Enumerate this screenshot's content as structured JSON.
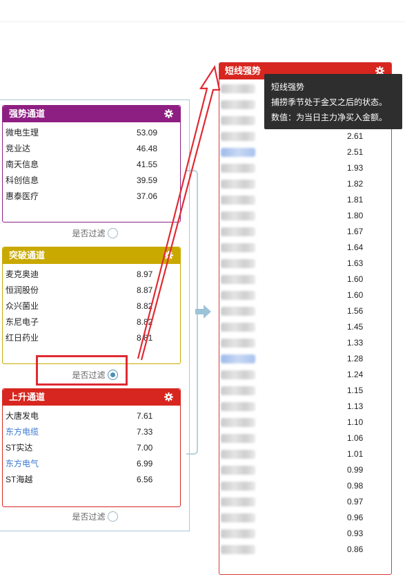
{
  "panels": {
    "strong": {
      "title": "强势通道",
      "color": "#8e1f82",
      "rows": [
        {
          "name": "微电生理",
          "value": "53.09",
          "link": false
        },
        {
          "name": "竞业达",
          "value": "46.48",
          "link": false
        },
        {
          "name": "南天信息",
          "value": "41.55",
          "link": false
        },
        {
          "name": "科创信息",
          "value": "39.59",
          "link": false
        },
        {
          "name": "惠泰医疗",
          "value": "37.06",
          "link": false
        }
      ],
      "filter_label": "是否过滤",
      "filter_on": false
    },
    "breakout": {
      "title": "突破通道",
      "color": "#c9a900",
      "rows": [
        {
          "name": "麦克奥迪",
          "value": "8.97",
          "link": false
        },
        {
          "name": "恒润股份",
          "value": "8.87",
          "link": false
        },
        {
          "name": "众兴菌业",
          "value": "8.82",
          "link": false
        },
        {
          "name": "东尼电子",
          "value": "8.82",
          "link": false
        },
        {
          "name": "红日药业",
          "value": "8.81",
          "link": false
        }
      ],
      "filter_label": "是否过滤",
      "filter_on": true
    },
    "rising": {
      "title": "上升通道",
      "color": "#d7261f",
      "rows": [
        {
          "name": "大唐发电",
          "value": "7.61",
          "link": false
        },
        {
          "name": "东方电缆",
          "value": "7.33",
          "link": true
        },
        {
          "name": "ST实达",
          "value": "7.00",
          "link": false
        },
        {
          "name": "东方电气",
          "value": "6.99",
          "link": true
        },
        {
          "name": "ST海越",
          "value": "6.56",
          "link": false
        }
      ],
      "filter_label": "是否过滤",
      "filter_on": false
    }
  },
  "short_term": {
    "title": "短线强势",
    "rows": [
      {
        "value": "",
        "blue": false
      },
      {
        "value": "",
        "blue": false
      },
      {
        "value": "",
        "blue": false
      },
      {
        "value": "2.61",
        "blue": false
      },
      {
        "value": "2.51",
        "blue": true
      },
      {
        "value": "1.93",
        "blue": false
      },
      {
        "value": "1.82",
        "blue": false
      },
      {
        "value": "1.81",
        "blue": false
      },
      {
        "value": "1.80",
        "blue": false
      },
      {
        "value": "1.67",
        "blue": false
      },
      {
        "value": "1.64",
        "blue": false
      },
      {
        "value": "1.63",
        "blue": false
      },
      {
        "value": "1.60",
        "blue": false
      },
      {
        "value": "1.60",
        "blue": false
      },
      {
        "value": "1.56",
        "blue": false
      },
      {
        "value": "1.45",
        "blue": false
      },
      {
        "value": "1.33",
        "blue": false
      },
      {
        "value": "1.28",
        "blue": true
      },
      {
        "value": "1.24",
        "blue": false
      },
      {
        "value": "1.15",
        "blue": false
      },
      {
        "value": "1.13",
        "blue": false
      },
      {
        "value": "1.10",
        "blue": false
      },
      {
        "value": "1.06",
        "blue": false
      },
      {
        "value": "1.01",
        "blue": false
      },
      {
        "value": "0.99",
        "blue": false
      },
      {
        "value": "0.98",
        "blue": false
      },
      {
        "value": "0.97",
        "blue": false
      },
      {
        "value": "0.96",
        "blue": false
      },
      {
        "value": "0.93",
        "blue": false
      },
      {
        "value": "0.86",
        "blue": false
      }
    ]
  },
  "tooltip": {
    "title": "短线强势",
    "line1": "捕捞季节处于金叉之后的状态。",
    "line2": "数值：为当日主力净买入金额。"
  },
  "icons": {
    "gear": "gear-icon",
    "flow_arrow": "arrow-right-icon",
    "annotation": "red-arrow-annotation"
  },
  "colors": {
    "annotation_red": "#e02a33",
    "link_blue": "#3a78d2",
    "bracket_blue": "#b7d1de"
  }
}
